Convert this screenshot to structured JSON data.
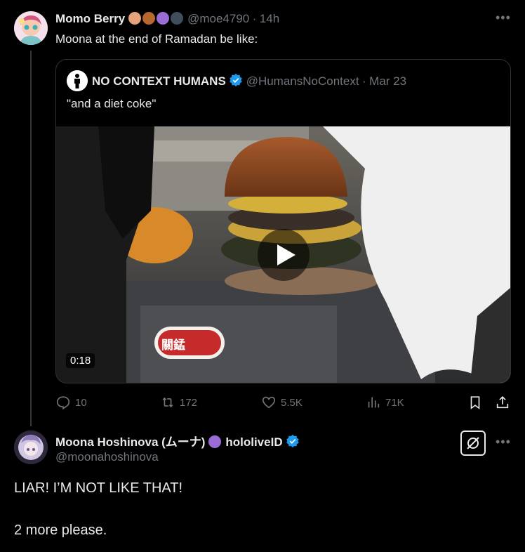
{
  "tweet": {
    "author_name": "Momo Berry",
    "author_emojis": [
      "palette-emoji",
      "squirrel-emoji",
      "crystal-ball-emoji",
      "person-emoji"
    ],
    "handle": "@moe4790",
    "separator": "·",
    "time": "14h",
    "text": "Moona at the end of Ramadan be like:"
  },
  "quote": {
    "author_name": "NO CONTEXT HUMANS",
    "handle": "@HumansNoContext",
    "separator": "·",
    "date": "Mar 23",
    "text": "\"and a diet coke\"",
    "video_duration": "0:18",
    "video_sign_text": "關錳"
  },
  "actions": {
    "replies": "10",
    "reposts": "172",
    "likes": "5.5K",
    "views": "71K"
  },
  "reply": {
    "author_name": "Moona Hoshinova (ムーナ)",
    "author_suffix": "hololiveID",
    "handle": "@moonahoshinova",
    "line1": "LIAR! I’M NOT LIKE THAT!",
    "line2": "2 more please."
  },
  "colors": {
    "background": "#000000",
    "text": "#e7e9ea",
    "muted": "#71767b",
    "verified_blue": "#1d9bf0",
    "border": "#2f3336"
  }
}
